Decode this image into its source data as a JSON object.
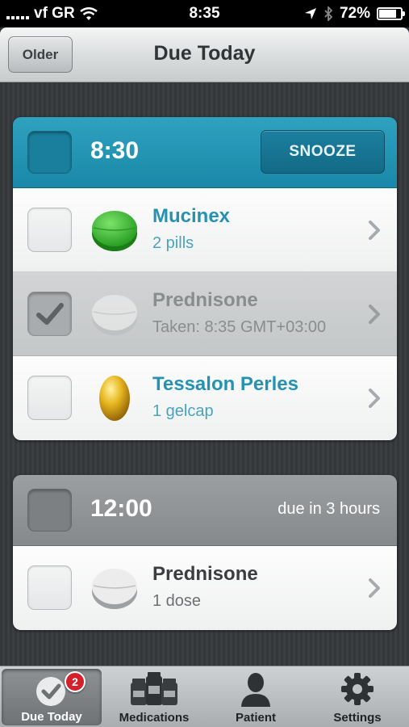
{
  "status_bar": {
    "carrier": "vf GR",
    "time": "8:35",
    "battery": "72%"
  },
  "nav": {
    "back_label": "Older",
    "title": "Due Today"
  },
  "groups": [
    {
      "time": "8:30",
      "action_label": "SNOOZE",
      "meds": [
        {
          "name": "Mucinex",
          "detail": "2 pills",
          "pill": "green-tablet-icon",
          "taken": false
        },
        {
          "name": "Prednisone",
          "detail": "Taken: 8:35 GMT+03:00",
          "pill": "white-tablet-icon",
          "taken": true
        },
        {
          "name": "Tessalon Perles",
          "detail": "1 gelcap",
          "pill": "gelcap-icon",
          "taken": false
        }
      ]
    },
    {
      "time": "12:00",
      "due_text": "due in 3 hours",
      "meds": [
        {
          "name": "Prednisone",
          "detail": "1 dose",
          "pill": "white-tablet-icon",
          "taken": false
        }
      ]
    }
  ],
  "tabs": [
    {
      "label": "Due Today",
      "icon": "checkmark-icon",
      "badge": "2",
      "active": true
    },
    {
      "label": "Medications",
      "icon": "pill-bottles-icon",
      "active": false
    },
    {
      "label": "Patient",
      "icon": "person-icon",
      "active": false
    },
    {
      "label": "Settings",
      "icon": "gear-icon",
      "active": false
    }
  ],
  "colors": {
    "accent": "#1a88a8",
    "med_name": "#2592b2",
    "badge": "#d3202a"
  }
}
